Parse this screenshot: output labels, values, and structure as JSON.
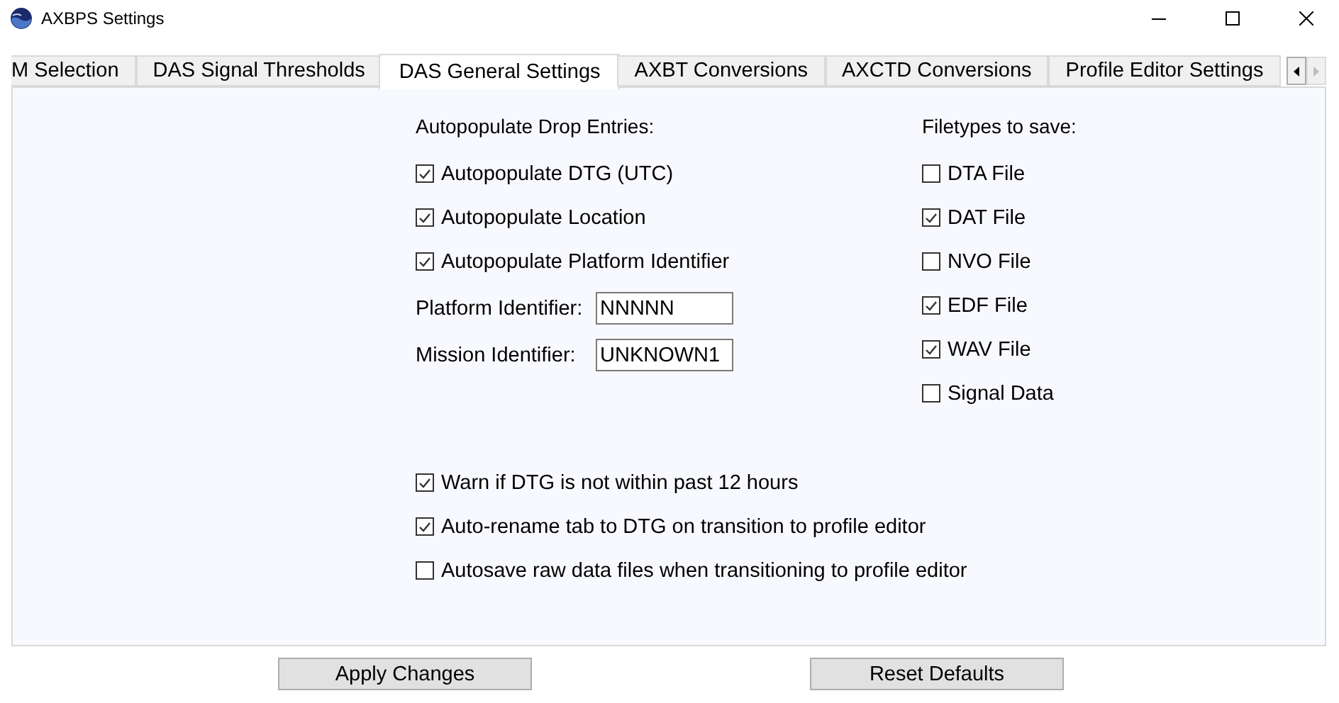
{
  "window": {
    "title": "AXBPS Settings"
  },
  "tabs": [
    {
      "label": "M Selection",
      "selected": false
    },
    {
      "label": "DAS Signal Thresholds",
      "selected": false
    },
    {
      "label": "DAS General Settings",
      "selected": true
    },
    {
      "label": "AXBT Conversions",
      "selected": false
    },
    {
      "label": "AXCTD Conversions",
      "selected": false
    },
    {
      "label": "Profile Editor Settings",
      "selected": false
    }
  ],
  "drop_entries": {
    "heading": "Autopopulate Drop Entries:",
    "checkboxes": [
      {
        "label": "Autopopulate DTG (UTC)",
        "checked": true
      },
      {
        "label": "Autopopulate Location",
        "checked": true
      },
      {
        "label": "Autopopulate Platform Identifier",
        "checked": true
      }
    ],
    "fields": [
      {
        "label": "Platform Identifier:",
        "value": "NNNNN"
      },
      {
        "label": "Mission Identifier:",
        "value": "UNKNOWN1"
      }
    ]
  },
  "filetypes": {
    "heading": "Filetypes to save:",
    "checkboxes": [
      {
        "label": "DTA File",
        "checked": false
      },
      {
        "label": "DAT File",
        "checked": true
      },
      {
        "label": "NVO File",
        "checked": false
      },
      {
        "label": "EDF File",
        "checked": true
      },
      {
        "label": "WAV File",
        "checked": true
      },
      {
        "label": "Signal Data",
        "checked": false
      }
    ]
  },
  "options": [
    {
      "label": "Warn if DTG is not within past 12 hours",
      "checked": true
    },
    {
      "label": "Auto-rename tab to DTG on transition to profile editor",
      "checked": true
    },
    {
      "label": "Autosave raw data files when transitioning to profile editor",
      "checked": false
    }
  ],
  "buttons": [
    "Apply Changes",
    "Reset Defaults"
  ]
}
